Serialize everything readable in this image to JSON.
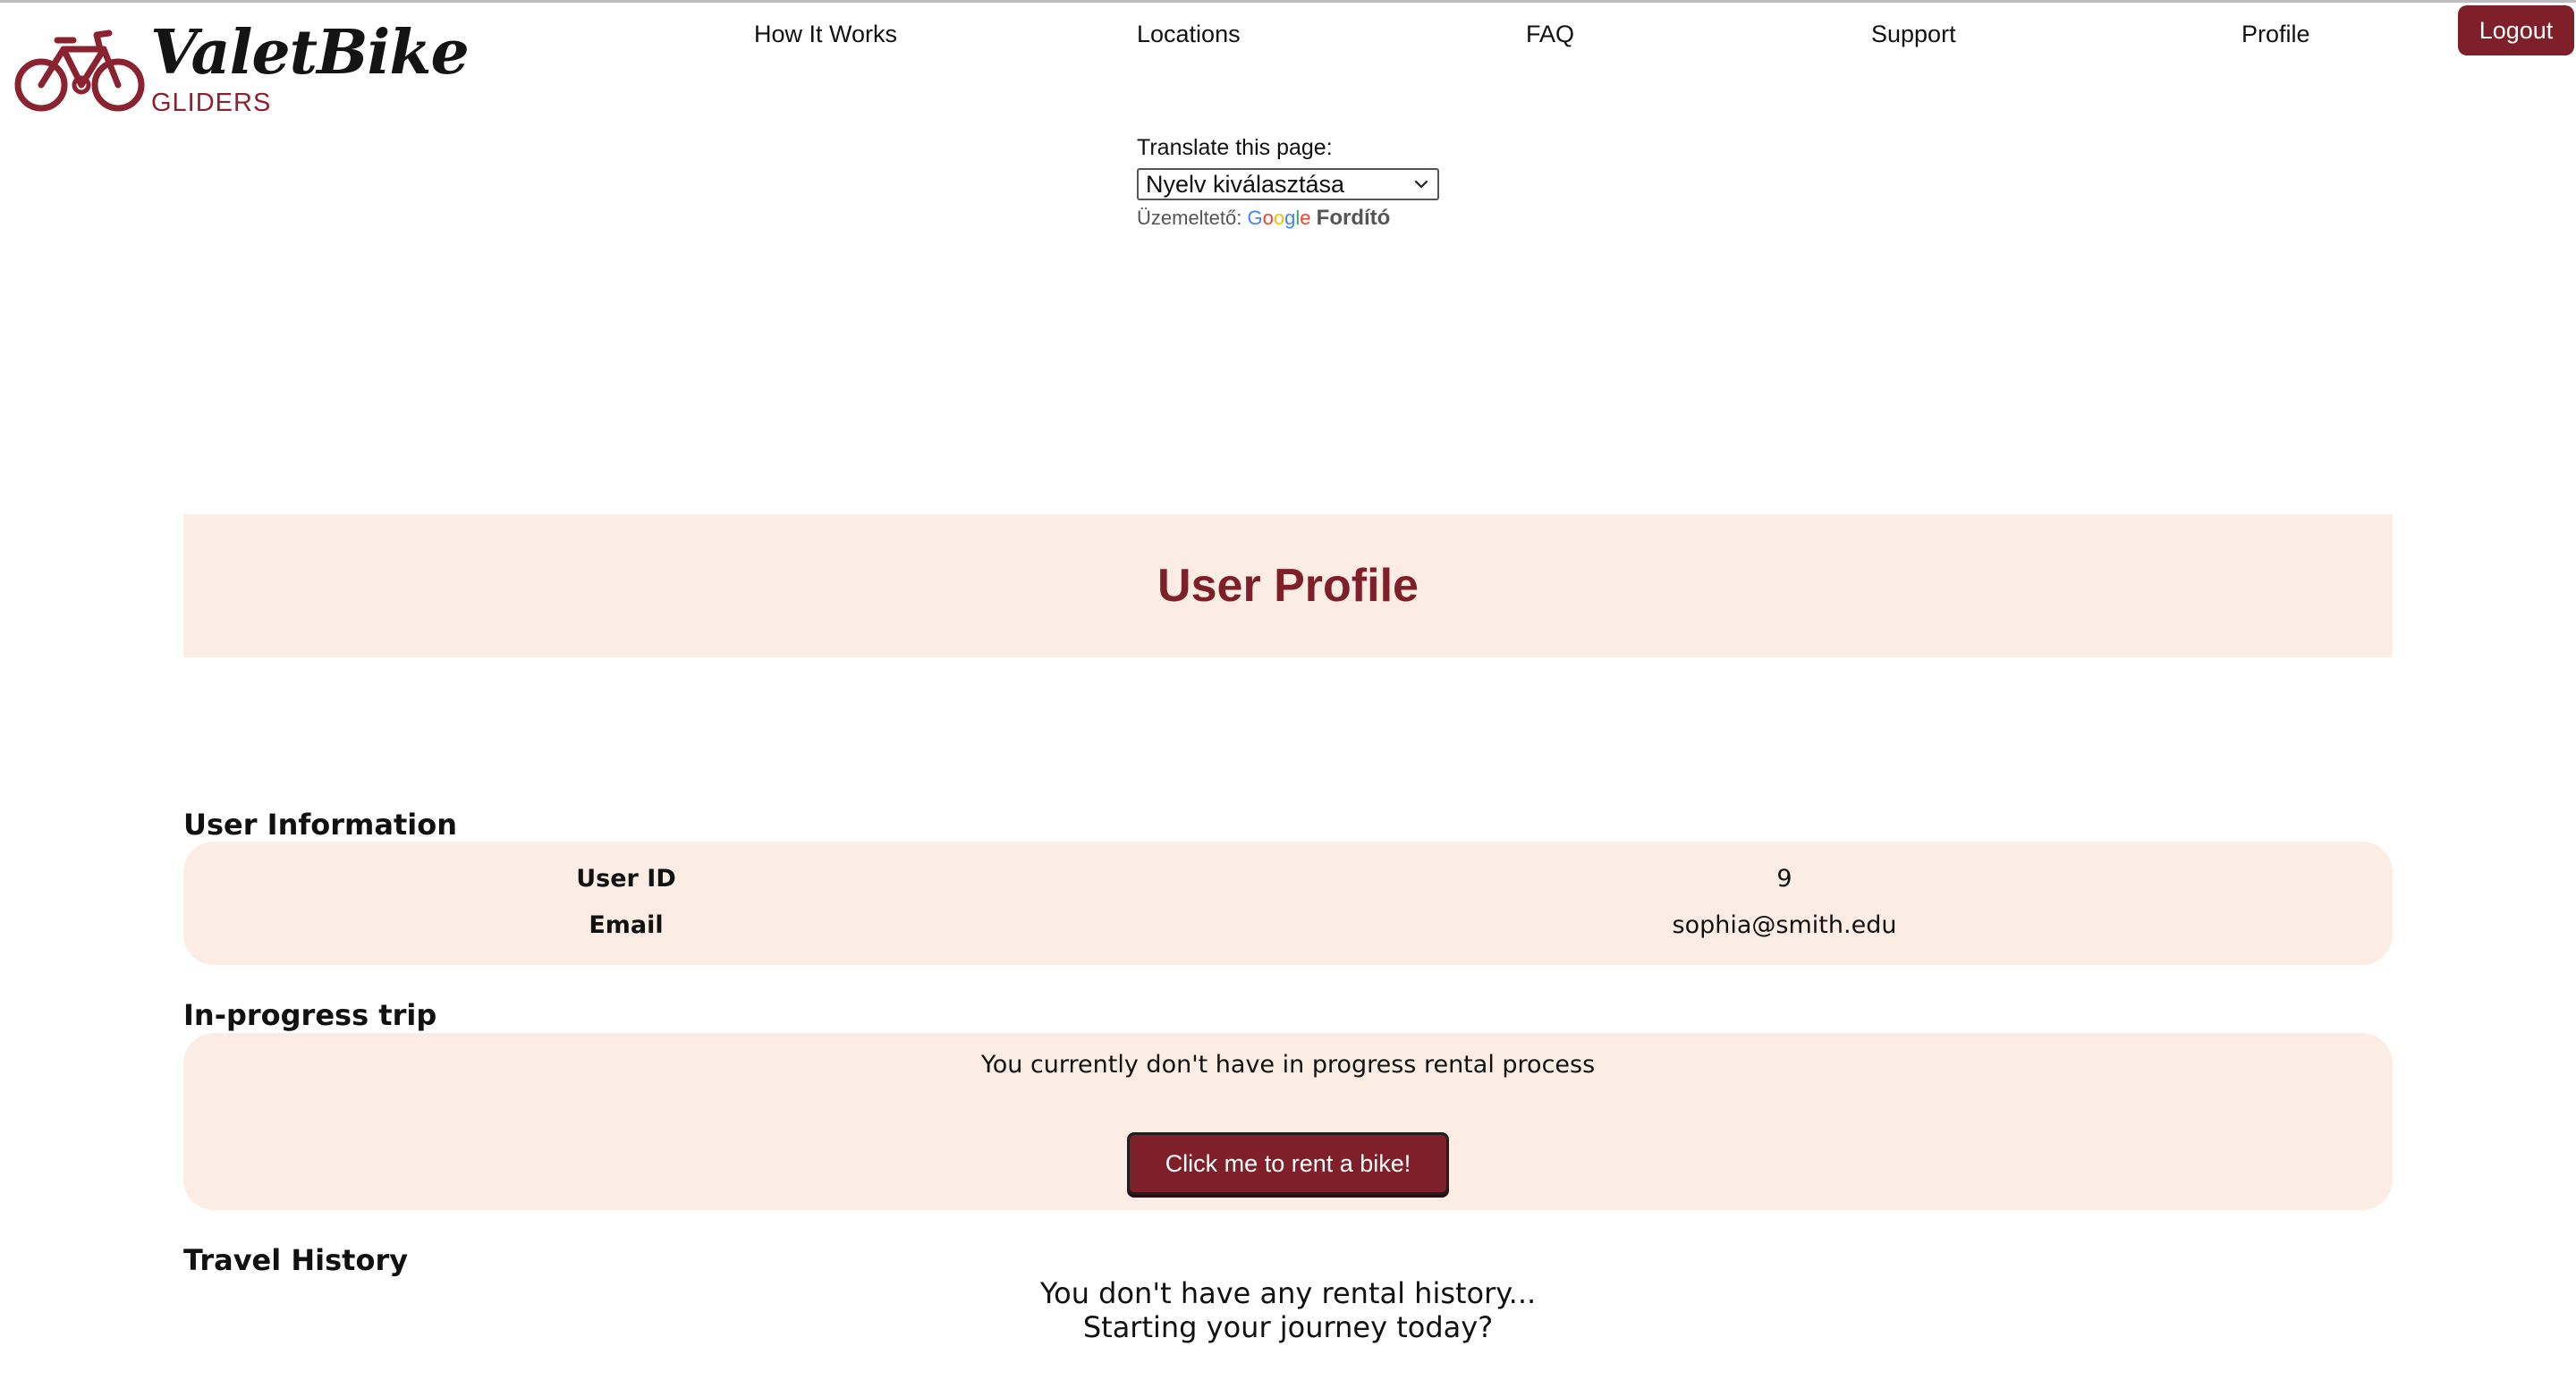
{
  "brand": {
    "name": "ValetBike",
    "subtitle": "GLIDERS",
    "accent_color": "#7f1f29",
    "panel_color": "#fbede3"
  },
  "nav": {
    "items": [
      {
        "label": "How It Works"
      },
      {
        "label": "Locations"
      },
      {
        "label": "FAQ"
      },
      {
        "label": "Support"
      },
      {
        "label": "Profile"
      }
    ],
    "logout_label": "Logout"
  },
  "translate": {
    "label": "Translate this page:",
    "selected_language": "Nyelv kiválasztása",
    "powered_by_prefix": "Üzemeltető:",
    "google_letters": [
      "G",
      "o",
      "o",
      "g",
      "l",
      "e"
    ],
    "service_name": "Fordító"
  },
  "profile": {
    "page_title": "User Profile",
    "user_info": {
      "heading": "User Information",
      "rows": [
        {
          "label": "User ID",
          "value": "9"
        },
        {
          "label": "Email",
          "value": "sophia@smith.edu"
        }
      ]
    },
    "trip": {
      "heading": "In-progress trip",
      "message": "You currently don't have in progress rental process",
      "rent_button_label": "Click me to rent a bike!"
    },
    "history": {
      "heading": "Travel History",
      "message_line1": "You don't have any rental history...",
      "message_line2": "Starting your journey today?"
    }
  }
}
